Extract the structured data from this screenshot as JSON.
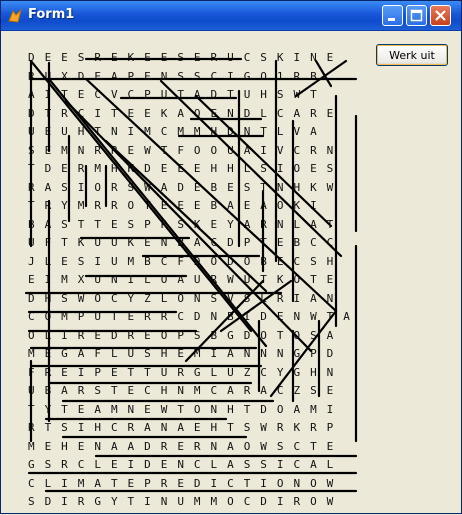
{
  "window": {
    "title": "Form1"
  },
  "titlebar_icons": [
    "app-icon",
    "minimize-icon",
    "maximize-icon",
    "close-icon"
  ],
  "toolbar": {
    "solve_label": "Werk uit"
  },
  "grid": {
    "rows": [
      "DEESREKEESERUCSKINE",
      "RUXDEAPENSSCIGO1RB",
      "AITECVCPUTADTUHSWT",
      "DTRCITEEKAOENDLCARE",
      "UEUHTNIMCMMHDNTLVA",
      "SEMNRREWTFOOUAIVCRN",
      "TDERMHKDEEEHHLSIOES",
      "RASIORSWADEBESTNHKW",
      "TRYMRROTEEEBAEAOKI",
      "BASTTESPRSKEYARNLAT",
      "UFTKUUKENBACDPTEBCC",
      "JLESIUMBCFDODOBECSH",
      "EIMXUNILOAURWUTKOTE",
      "DHSWOCYZLONSVSLRIAN",
      "COMPUTERRCDNBIDENWTA",
      "OLIREDREOPSBGDOTOSA",
      "MEGAFLUSHEMIANNNGPD",
      "FREIPETTURGLUZCYGHN",
      "UBARSTECHNMCARACZSE",
      "TYTEAMNEWTONHTDOAMI",
      "RTSIHCRANAEHTSWRKRP",
      "MEHENAADRERNAOWSCTE",
      "GSRCLEIDENCLASSICAL",
      "CLIMATEPREDICTIONOW",
      "SDIRGYTINUMMOCDIROW"
    ]
  }
}
